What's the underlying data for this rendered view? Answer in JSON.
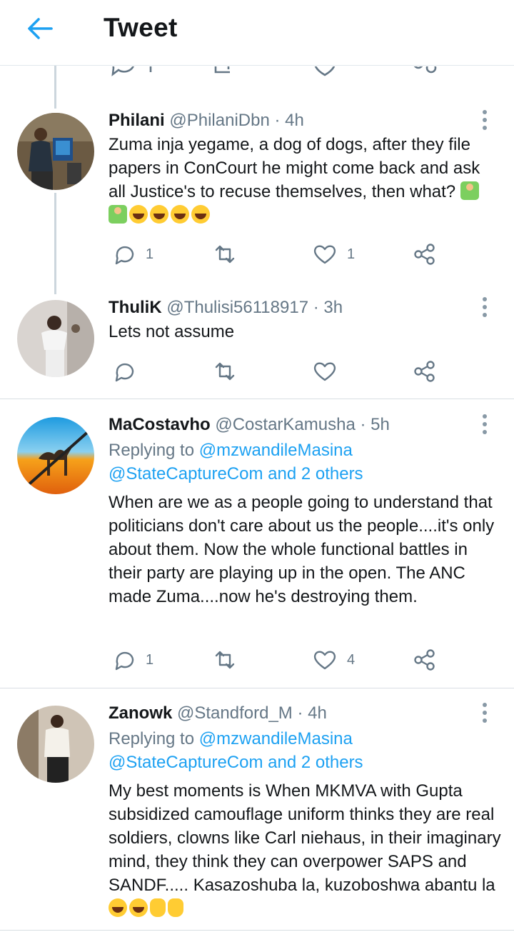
{
  "header": {
    "title": "Tweet"
  },
  "tweets": [
    {
      "name": "Philani",
      "handle": "@PhilaniDbn",
      "time": "· 4h",
      "replying_prefix": "",
      "replying_line1": "",
      "replying_line2": "",
      "body": "Zuma inja yegame, a dog of dogs, after they file papers in ConCourt he might come back and ask all Justice's to recuse themselves, then what?",
      "replies": "1",
      "retweets": "",
      "likes": "1"
    },
    {
      "name": "ThuliK",
      "handle": "@Thulisi56118917",
      "time": "· 3h",
      "body": "Lets not assume",
      "replies": "",
      "retweets": "",
      "likes": ""
    },
    {
      "name": "MaCostavho",
      "handle": "@CostarKamusha",
      "time": "· 5h",
      "replying_prefix": "Replying to ",
      "replying_line1": "@mzwandileMasina",
      "replying_line2": "@StateCaptureCom and 2 others",
      "body": "When are we as a people going to understand that politicians don't care about us the people....it's only about them. Now the whole functional battles in their party are playing up in the open. The ANC made Zuma....now he's destroying them.",
      "replies": "1",
      "retweets": "",
      "likes": "4"
    },
    {
      "name": "Zanowk",
      "handle": "@Standford_M",
      "time": "· 4h",
      "replying_prefix": "Replying to ",
      "replying_line1": "@mzwandileMasina",
      "replying_line2": "@StateCaptureCom and 2 others",
      "body": "My best moments is When MKMVA with Gupta subsidized camouflage uniform thinks they are real soldiers,  clowns like Carl niehaus, in their imaginary mind, they think they can overpower SAPS and SANDF..... Kasazoshuba la, kuzoboshwa abantu la",
      "replies": "",
      "retweets": "",
      "likes": ""
    }
  ],
  "icons": {
    "back": "arrow-left-icon",
    "reply": "reply-icon",
    "retweet": "retweet-icon",
    "like": "heart-icon",
    "share": "share-icon",
    "more": "more-vertical-icon"
  },
  "colors": {
    "accent": "#1da1f2",
    "muted": "#657786",
    "text": "#14171a"
  }
}
